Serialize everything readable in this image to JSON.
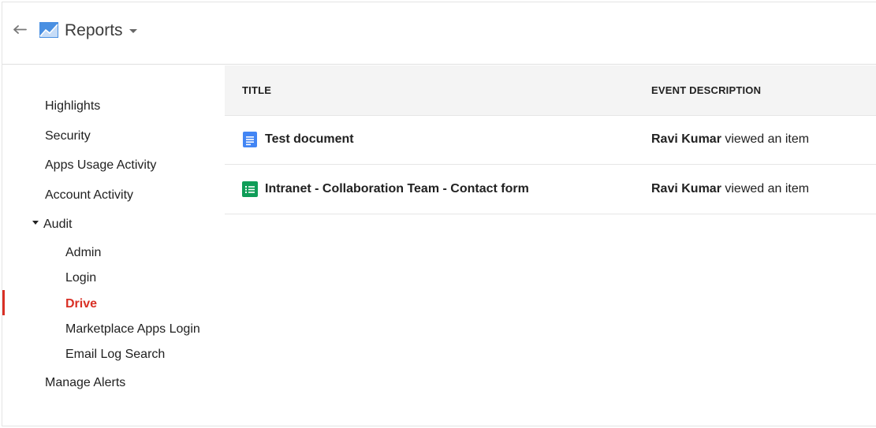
{
  "header": {
    "title": "Reports",
    "back_icon": "back-arrow-icon",
    "logo_icon": "reports-chart-icon"
  },
  "sidebar": {
    "items": [
      {
        "label": "Highlights"
      },
      {
        "label": "Security"
      },
      {
        "label": "Apps Usage Activity"
      },
      {
        "label": "Account Activity"
      },
      {
        "label": "Audit",
        "expanded": true
      },
      {
        "label": "Admin"
      },
      {
        "label": "Login"
      },
      {
        "label": "Drive",
        "active": true
      },
      {
        "label": "Marketplace Apps Login"
      },
      {
        "label": "Email Log Search"
      },
      {
        "label": "Manage Alerts"
      }
    ]
  },
  "table": {
    "columns": [
      "TITLE",
      "EVENT DESCRIPTION"
    ],
    "rows": [
      {
        "title": "Test document",
        "icon": "google-docs-icon",
        "actor": "Ravi Kumar",
        "action": " viewed an item"
      },
      {
        "title": "Intranet - Collaboration Team - Contact form",
        "icon": "google-forms-icon",
        "actor": "Ravi Kumar",
        "action": " viewed an item"
      }
    ]
  },
  "colors": {
    "accent": "#d93025",
    "docs_blue": "#4285f4",
    "forms_green": "#0f9d58",
    "header_bg": "#f4f4f4"
  }
}
